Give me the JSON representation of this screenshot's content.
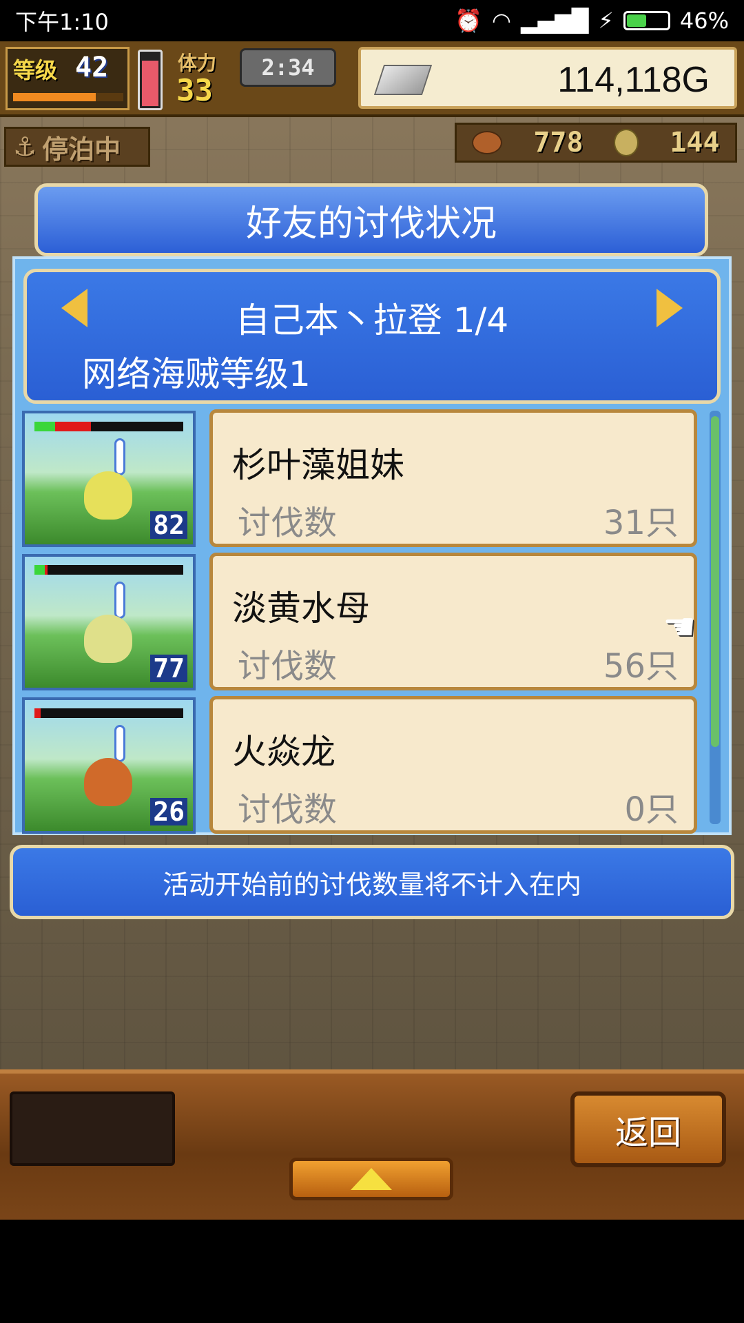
{
  "status_bar": {
    "time": "下午1:10",
    "battery": "46%",
    "battery_level": 0.46
  },
  "hud": {
    "level_label": "等级",
    "level_value": "42",
    "stamina_label": "体力",
    "stamina_value": "33",
    "timer": "2:34",
    "gold": "114,118G",
    "docked_label": "停泊中",
    "food_count": "778",
    "medal_count": "144"
  },
  "dialog": {
    "title": "好友的讨伐状况",
    "stage_title": "自己本丶拉登 1/4",
    "stage_subtitle": "网络海贼等级1",
    "monsters": [
      {
        "name": "杉叶藻姐妹",
        "kill_label": "讨伐数",
        "kill_count": "31只",
        "level": "82",
        "hp_green": 0.14,
        "hp_red": 0.24,
        "color": "#e6e05a"
      },
      {
        "name": "淡黄水母",
        "kill_label": "讨伐数",
        "kill_count": "56只",
        "level": "77",
        "hp_green": 0.07,
        "hp_red": 0.02,
        "color": "#dfe08a"
      },
      {
        "name": "火焱龙",
        "kill_label": "讨伐数",
        "kill_count": "0只",
        "level": "26",
        "hp_green": 0.0,
        "hp_red": 0.04,
        "color": "#d06a2a"
      }
    ],
    "notice": "活动开始前的讨伐数量将不计入在内"
  },
  "bottom": {
    "back_label": "返回"
  },
  "colors": {
    "panel_blue": "#2a5fd4",
    "card_bg": "#f7e9cc",
    "gold_text": "#f6d84a"
  }
}
